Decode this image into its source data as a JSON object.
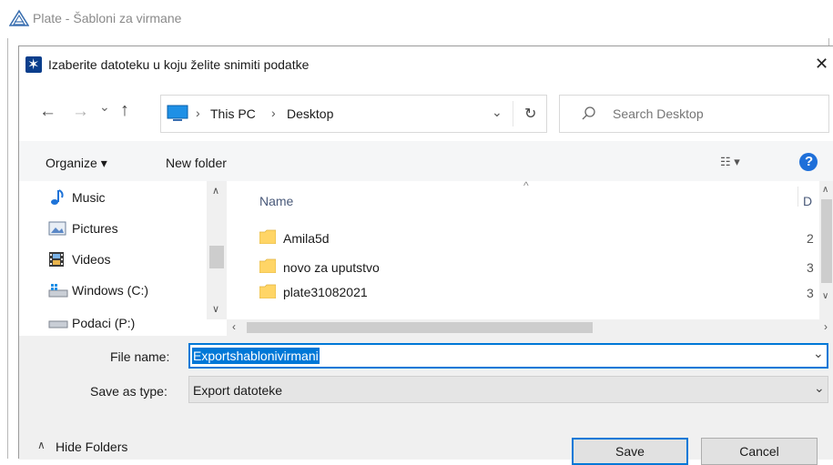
{
  "parent_window": {
    "title": "Plate - Šabloni za virmane"
  },
  "dialog": {
    "title": "Izaberite datoteku u koju želite snimiti podatke",
    "close_glyph": "✕",
    "nav": {
      "back": "←",
      "forward": "→",
      "recent": "⌄",
      "up": "↑"
    },
    "breadcrumb": {
      "sep1": "›",
      "pc": "This PC",
      "sep2": "›",
      "desktop": "Desktop",
      "dropdown": "⌄",
      "refresh": "↻"
    },
    "search": {
      "placeholder": "Search Desktop"
    },
    "toolbar": {
      "organize": "Organize ▾",
      "new_folder": "New folder",
      "view_glyph": "☷ ▾",
      "help": "?"
    },
    "nav_pane": {
      "items": [
        {
          "label": "Music",
          "icon": "music-icon"
        },
        {
          "label": "Pictures",
          "icon": "pictures-icon"
        },
        {
          "label": "Videos",
          "icon": "videos-icon"
        },
        {
          "label": "Windows (C:)",
          "icon": "drive-icon"
        },
        {
          "label": "Podaci (P:)",
          "icon": "drive-icon"
        }
      ]
    },
    "file_list": {
      "columns": {
        "name": "Name",
        "date": "D"
      },
      "rows": [
        {
          "name": "Amila5d",
          "date": "2"
        },
        {
          "name": "novo za uputstvo",
          "date": "3"
        },
        {
          "name": "plate31082021",
          "date": "3"
        }
      ]
    },
    "file_name": {
      "label": "File name:",
      "value": "Exportshablonivirmani"
    },
    "save_type": {
      "label": "Save as type:",
      "value": "Export datoteke"
    },
    "hide_folders": "Hide Folders",
    "save_button": "Save",
    "cancel_button": "Cancel",
    "colors": {
      "accent": "#0078d7",
      "folder": "#ffd566",
      "help": "#1e6fd9",
      "selection": "#0078d7"
    }
  }
}
